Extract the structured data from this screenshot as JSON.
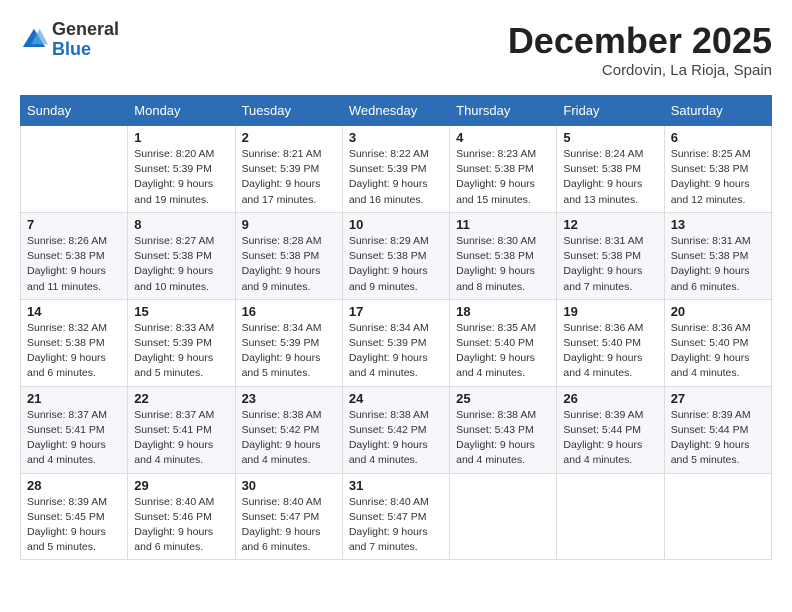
{
  "header": {
    "logo_general": "General",
    "logo_blue": "Blue",
    "month_title": "December 2025",
    "location": "Cordovin, La Rioja, Spain"
  },
  "weekdays": [
    "Sunday",
    "Monday",
    "Tuesday",
    "Wednesday",
    "Thursday",
    "Friday",
    "Saturday"
  ],
  "weeks": [
    [
      {
        "day": "",
        "info": ""
      },
      {
        "day": "1",
        "info": "Sunrise: 8:20 AM\nSunset: 5:39 PM\nDaylight: 9 hours\nand 19 minutes."
      },
      {
        "day": "2",
        "info": "Sunrise: 8:21 AM\nSunset: 5:39 PM\nDaylight: 9 hours\nand 17 minutes."
      },
      {
        "day": "3",
        "info": "Sunrise: 8:22 AM\nSunset: 5:39 PM\nDaylight: 9 hours\nand 16 minutes."
      },
      {
        "day": "4",
        "info": "Sunrise: 8:23 AM\nSunset: 5:38 PM\nDaylight: 9 hours\nand 15 minutes."
      },
      {
        "day": "5",
        "info": "Sunrise: 8:24 AM\nSunset: 5:38 PM\nDaylight: 9 hours\nand 13 minutes."
      },
      {
        "day": "6",
        "info": "Sunrise: 8:25 AM\nSunset: 5:38 PM\nDaylight: 9 hours\nand 12 minutes."
      }
    ],
    [
      {
        "day": "7",
        "info": "Sunrise: 8:26 AM\nSunset: 5:38 PM\nDaylight: 9 hours\nand 11 minutes."
      },
      {
        "day": "8",
        "info": "Sunrise: 8:27 AM\nSunset: 5:38 PM\nDaylight: 9 hours\nand 10 minutes."
      },
      {
        "day": "9",
        "info": "Sunrise: 8:28 AM\nSunset: 5:38 PM\nDaylight: 9 hours\nand 9 minutes."
      },
      {
        "day": "10",
        "info": "Sunrise: 8:29 AM\nSunset: 5:38 PM\nDaylight: 9 hours\nand 9 minutes."
      },
      {
        "day": "11",
        "info": "Sunrise: 8:30 AM\nSunset: 5:38 PM\nDaylight: 9 hours\nand 8 minutes."
      },
      {
        "day": "12",
        "info": "Sunrise: 8:31 AM\nSunset: 5:38 PM\nDaylight: 9 hours\nand 7 minutes."
      },
      {
        "day": "13",
        "info": "Sunrise: 8:31 AM\nSunset: 5:38 PM\nDaylight: 9 hours\nand 6 minutes."
      }
    ],
    [
      {
        "day": "14",
        "info": "Sunrise: 8:32 AM\nSunset: 5:38 PM\nDaylight: 9 hours\nand 6 minutes."
      },
      {
        "day": "15",
        "info": "Sunrise: 8:33 AM\nSunset: 5:39 PM\nDaylight: 9 hours\nand 5 minutes."
      },
      {
        "day": "16",
        "info": "Sunrise: 8:34 AM\nSunset: 5:39 PM\nDaylight: 9 hours\nand 5 minutes."
      },
      {
        "day": "17",
        "info": "Sunrise: 8:34 AM\nSunset: 5:39 PM\nDaylight: 9 hours\nand 4 minutes."
      },
      {
        "day": "18",
        "info": "Sunrise: 8:35 AM\nSunset: 5:40 PM\nDaylight: 9 hours\nand 4 minutes."
      },
      {
        "day": "19",
        "info": "Sunrise: 8:36 AM\nSunset: 5:40 PM\nDaylight: 9 hours\nand 4 minutes."
      },
      {
        "day": "20",
        "info": "Sunrise: 8:36 AM\nSunset: 5:40 PM\nDaylight: 9 hours\nand 4 minutes."
      }
    ],
    [
      {
        "day": "21",
        "info": "Sunrise: 8:37 AM\nSunset: 5:41 PM\nDaylight: 9 hours\nand 4 minutes."
      },
      {
        "day": "22",
        "info": "Sunrise: 8:37 AM\nSunset: 5:41 PM\nDaylight: 9 hours\nand 4 minutes."
      },
      {
        "day": "23",
        "info": "Sunrise: 8:38 AM\nSunset: 5:42 PM\nDaylight: 9 hours\nand 4 minutes."
      },
      {
        "day": "24",
        "info": "Sunrise: 8:38 AM\nSunset: 5:42 PM\nDaylight: 9 hours\nand 4 minutes."
      },
      {
        "day": "25",
        "info": "Sunrise: 8:38 AM\nSunset: 5:43 PM\nDaylight: 9 hours\nand 4 minutes."
      },
      {
        "day": "26",
        "info": "Sunrise: 8:39 AM\nSunset: 5:44 PM\nDaylight: 9 hours\nand 4 minutes."
      },
      {
        "day": "27",
        "info": "Sunrise: 8:39 AM\nSunset: 5:44 PM\nDaylight: 9 hours\nand 5 minutes."
      }
    ],
    [
      {
        "day": "28",
        "info": "Sunrise: 8:39 AM\nSunset: 5:45 PM\nDaylight: 9 hours\nand 5 minutes."
      },
      {
        "day": "29",
        "info": "Sunrise: 8:40 AM\nSunset: 5:46 PM\nDaylight: 9 hours\nand 6 minutes."
      },
      {
        "day": "30",
        "info": "Sunrise: 8:40 AM\nSunset: 5:47 PM\nDaylight: 9 hours\nand 6 minutes."
      },
      {
        "day": "31",
        "info": "Sunrise: 8:40 AM\nSunset: 5:47 PM\nDaylight: 9 hours\nand 7 minutes."
      },
      {
        "day": "",
        "info": ""
      },
      {
        "day": "",
        "info": ""
      },
      {
        "day": "",
        "info": ""
      }
    ]
  ]
}
